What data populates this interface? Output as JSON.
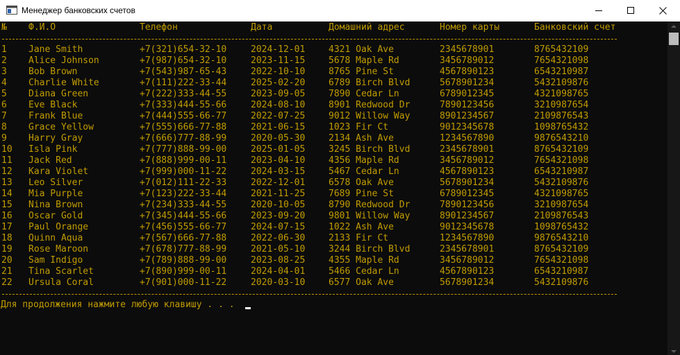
{
  "window": {
    "title": "Менеджер банковских счетов"
  },
  "table": {
    "headers": {
      "num": "№",
      "name": "Ф.И.О",
      "phone": "Телефон",
      "date": "Дата",
      "address": "Домашний адрес",
      "card": "Номер карты",
      "account": "Банковский счет"
    },
    "rows": [
      {
        "num": "1",
        "name": "Jane Smith",
        "phone": "+7(321)654-32-10",
        "date": "2024-12-01",
        "address": "4321 Oak Ave",
        "card": "2345678901",
        "account": "8765432109"
      },
      {
        "num": "2",
        "name": "Alice Johnson",
        "phone": "+7(987)654-32-10",
        "date": "2023-11-15",
        "address": "5678 Maple Rd",
        "card": "3456789012",
        "account": "7654321098"
      },
      {
        "num": "3",
        "name": "Bob Brown",
        "phone": "+7(543)987-65-43",
        "date": "2022-10-10",
        "address": "8765 Pine St",
        "card": "4567890123",
        "account": "6543210987"
      },
      {
        "num": "4",
        "name": "Charlie White",
        "phone": "+7(111)222-33-44",
        "date": "2025-02-20",
        "address": "6789 Birch Blvd",
        "card": "5678901234",
        "account": "5432109876"
      },
      {
        "num": "5",
        "name": "Diana Green",
        "phone": "+7(222)333-44-55",
        "date": "2023-09-05",
        "address": "7890 Cedar Ln",
        "card": "6789012345",
        "account": "4321098765"
      },
      {
        "num": "6",
        "name": "Eve Black",
        "phone": "+7(333)444-55-66",
        "date": "2024-08-10",
        "address": "8901 Redwood Dr",
        "card": "7890123456",
        "account": "3210987654"
      },
      {
        "num": "7",
        "name": "Frank Blue",
        "phone": "+7(444)555-66-77",
        "date": "2022-07-25",
        "address": "9012 Willow Way",
        "card": "8901234567",
        "account": "2109876543"
      },
      {
        "num": "8",
        "name": "Grace Yellow",
        "phone": "+7(555)666-77-88",
        "date": "2021-06-15",
        "address": "1023 Fir Ct",
        "card": "9012345678",
        "account": "1098765432"
      },
      {
        "num": "9",
        "name": "Harry Gray",
        "phone": "+7(666)777-88-99",
        "date": "2020-05-30",
        "address": "2134 Ash Ave",
        "card": "1234567890",
        "account": "9876543210"
      },
      {
        "num": "10",
        "name": "Isla Pink",
        "phone": "+7(777)888-99-00",
        "date": "2025-01-05",
        "address": "3245 Birch Blvd",
        "card": "2345678901",
        "account": "8765432109"
      },
      {
        "num": "11",
        "name": "Jack Red",
        "phone": "+7(888)999-00-11",
        "date": "2023-04-10",
        "address": "4356 Maple Rd",
        "card": "3456789012",
        "account": "7654321098"
      },
      {
        "num": "12",
        "name": "Kara Violet",
        "phone": "+7(999)000-11-22",
        "date": "2024-03-15",
        "address": "5467 Cedar Ln",
        "card": "4567890123",
        "account": "6543210987"
      },
      {
        "num": "13",
        "name": "Leo Silver",
        "phone": "+7(012)111-22-33",
        "date": "2022-12-01",
        "address": "6578 Oak Ave",
        "card": "5678901234",
        "account": "5432109876"
      },
      {
        "num": "14",
        "name": "Mia Purple",
        "phone": "+7(123)222-33-44",
        "date": "2021-11-25",
        "address": "7689 Pine St",
        "card": "6789012345",
        "account": "4321098765"
      },
      {
        "num": "15",
        "name": "Nina Brown",
        "phone": "+7(234)333-44-55",
        "date": "2020-10-05",
        "address": "8790 Redwood Dr",
        "card": "7890123456",
        "account": "3210987654"
      },
      {
        "num": "16",
        "name": "Oscar Gold",
        "phone": "+7(345)444-55-66",
        "date": "2023-09-20",
        "address": "9801 Willow Way",
        "card": "8901234567",
        "account": "2109876543"
      },
      {
        "num": "17",
        "name": "Paul Orange",
        "phone": "+7(456)555-66-77",
        "date": "2024-07-15",
        "address": "1022 Ash Ave",
        "card": "9012345678",
        "account": "1098765432"
      },
      {
        "num": "18",
        "name": "Quinn Aqua",
        "phone": "+7(567)666-77-88",
        "date": "2022-06-30",
        "address": "2133 Fir Ct",
        "card": "1234567890",
        "account": "9876543210"
      },
      {
        "num": "19",
        "name": "Rose Maroon",
        "phone": "+7(678)777-88-99",
        "date": "2021-05-10",
        "address": "3244 Birch Blvd",
        "card": "2345678901",
        "account": "8765432109"
      },
      {
        "num": "20",
        "name": "Sam Indigo",
        "phone": "+7(789)888-99-00",
        "date": "2023-08-25",
        "address": "4355 Maple Rd",
        "card": "3456789012",
        "account": "7654321098"
      },
      {
        "num": "21",
        "name": "Tina Scarlet",
        "phone": "+7(890)999-00-11",
        "date": "2024-04-01",
        "address": "5466 Cedar Ln",
        "card": "4567890123",
        "account": "6543210987"
      },
      {
        "num": "22",
        "name": "Ursula Coral",
        "phone": "+7(901)000-11-22",
        "date": "2020-03-10",
        "address": "6577 Oak Ave",
        "card": "5678901234",
        "account": "5432109876"
      }
    ]
  },
  "prompt": {
    "text": "Для продолжения нажмите любую клавишу . . ."
  },
  "colors": {
    "console_background": "#0c0c0c",
    "console_text": "#c19c00",
    "titlebar_background": "#ffffff"
  },
  "icons": {
    "app": "console-app-icon",
    "minimize": "minimize-icon",
    "maximize": "maximize-icon",
    "close": "close-icon"
  }
}
